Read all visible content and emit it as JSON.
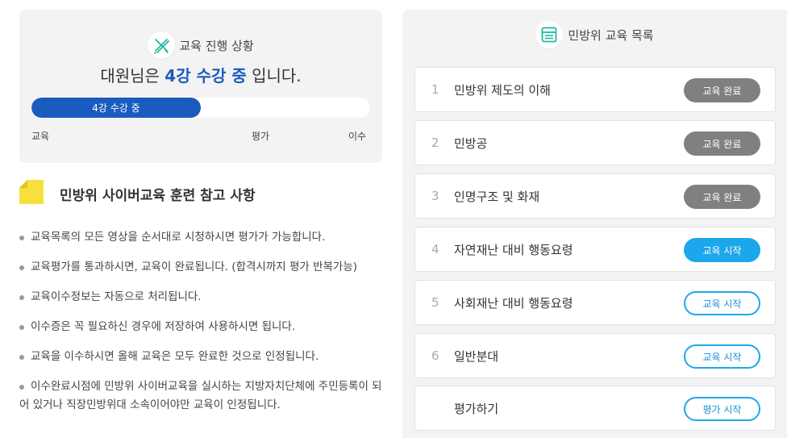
{
  "progress": {
    "title": "교육 진행 상황",
    "status_prefix": "대원님은",
    "status_highlight": "4강 수강 중",
    "status_suffix": "입니다.",
    "bar_label": "4강 수강 중",
    "bar_fraction": 0.5,
    "accent_color": "#1a5bbf",
    "steps": [
      "교육",
      "평가",
      "이수"
    ]
  },
  "notes": {
    "title": "민방위 사이버교육 훈련 참고 사항",
    "items": [
      "교육목록의 모든 영상을 순서대로 시청하시면 평가가 가능합니다.",
      "교육평가를 통과하시면, 교육이 완료됩니다. (합격시까지 평가 반복가능)",
      "교육이수정보는 자동으로 처리됩니다.",
      "이수증은 꼭 필요하신 경우에 저장하여 사용하시면 됩니다.",
      "교육을 이수하시면 올해 교육은 모두 완료한 것으로 인정됩니다.",
      "이수완료시점에 민방위 사이버교육을 실시하는 지방자치단체에 주민등록이 되어 있거나 직장민방위대 소속이어야만 교육이 인정됩니다."
    ]
  },
  "curriculum": {
    "title": "민방위 교육 목록",
    "courses": [
      {
        "num": "1",
        "name": "민방위 제도의 이해",
        "button": "교육 완료",
        "state": "done"
      },
      {
        "num": "2",
        "name": "민방공",
        "button": "교육 완료",
        "state": "done"
      },
      {
        "num": "3",
        "name": "인명구조 및 화재",
        "button": "교육 완료",
        "state": "done"
      },
      {
        "num": "4",
        "name": "자연재난 대비 행동요령",
        "button": "교육 시작",
        "state": "current"
      },
      {
        "num": "5",
        "name": "사회재난 대비 행동요령",
        "button": "교육 시작",
        "state": "pending"
      },
      {
        "num": "6",
        "name": "일반분대",
        "button": "교육 시작",
        "state": "pending"
      },
      {
        "num": "",
        "name": "평가하기",
        "button": "평가 시작",
        "state": "pending"
      }
    ]
  },
  "icons": {
    "progress": "pencil-ruler-icon",
    "curriculum": "list-board-icon",
    "notes": "sticky-note-icon"
  }
}
